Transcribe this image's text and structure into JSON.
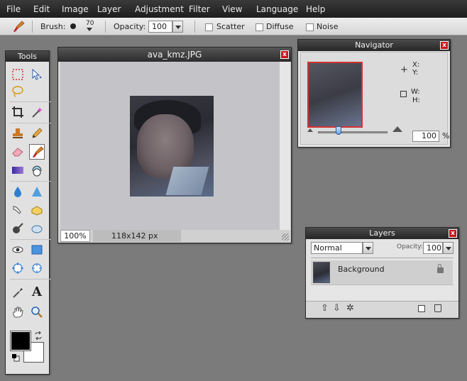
{
  "menu": [
    "File",
    "Edit",
    "Image",
    "Layer",
    "Adjustment",
    "Filter",
    "View",
    "Language",
    "Help"
  ],
  "options": {
    "brush_label": "Brush:",
    "brush_size": "70",
    "opacity_label": "Opacity:",
    "opacity_value": "100",
    "scatter_label": "Scatter",
    "diffuse_label": "Diffuse",
    "noise_label": "Noise"
  },
  "tools_panel": {
    "title": "Tools",
    "text_tool_glyph": "A"
  },
  "document": {
    "title": "ava_kmz.JPG",
    "zoom": "100%",
    "dimensions": "118x142 px"
  },
  "navigator": {
    "title": "Navigator",
    "x_label": "X:",
    "y_label": "Y:",
    "w_label": "W:",
    "h_label": "H:",
    "zoom_value": "100",
    "zoom_unit": "%"
  },
  "layers": {
    "title": "Layers",
    "blend_mode": "Normal",
    "opacity_label": "Opacity:",
    "opacity_value": "100",
    "layer_name": "Background"
  },
  "colors": {
    "foreground": "#000000",
    "background": "#ffffff"
  },
  "close_glyph": "x"
}
